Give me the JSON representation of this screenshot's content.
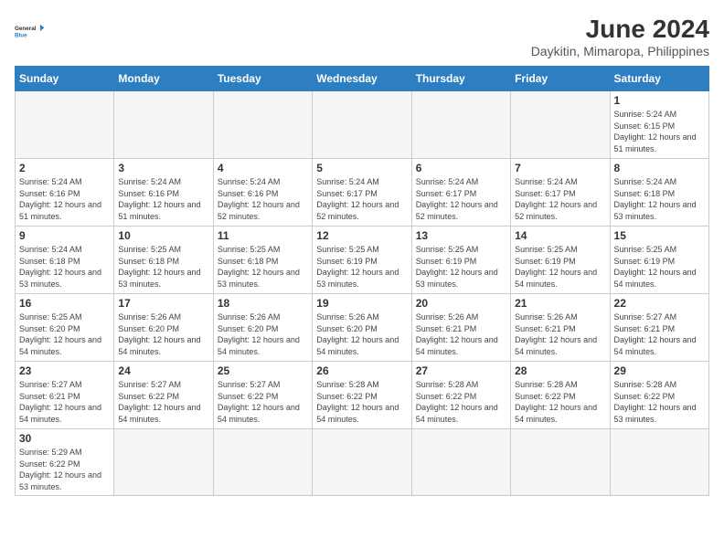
{
  "header": {
    "logo_general": "General",
    "logo_blue": "Blue",
    "main_title": "June 2024",
    "subtitle": "Daykitin, Mimaropa, Philippines"
  },
  "weekdays": [
    "Sunday",
    "Monday",
    "Tuesday",
    "Wednesday",
    "Thursday",
    "Friday",
    "Saturday"
  ],
  "weeks": [
    [
      {
        "day": null,
        "info": null
      },
      {
        "day": null,
        "info": null
      },
      {
        "day": null,
        "info": null
      },
      {
        "day": null,
        "info": null
      },
      {
        "day": null,
        "info": null
      },
      {
        "day": null,
        "info": null
      },
      {
        "day": "1",
        "info": "Sunrise: 5:24 AM\nSunset: 6:15 PM\nDaylight: 12 hours and 51 minutes."
      }
    ],
    [
      {
        "day": "2",
        "info": "Sunrise: 5:24 AM\nSunset: 6:16 PM\nDaylight: 12 hours and 51 minutes."
      },
      {
        "day": "3",
        "info": "Sunrise: 5:24 AM\nSunset: 6:16 PM\nDaylight: 12 hours and 51 minutes."
      },
      {
        "day": "4",
        "info": "Sunrise: 5:24 AM\nSunset: 6:16 PM\nDaylight: 12 hours and 52 minutes."
      },
      {
        "day": "5",
        "info": "Sunrise: 5:24 AM\nSunset: 6:17 PM\nDaylight: 12 hours and 52 minutes."
      },
      {
        "day": "6",
        "info": "Sunrise: 5:24 AM\nSunset: 6:17 PM\nDaylight: 12 hours and 52 minutes."
      },
      {
        "day": "7",
        "info": "Sunrise: 5:24 AM\nSunset: 6:17 PM\nDaylight: 12 hours and 52 minutes."
      },
      {
        "day": "8",
        "info": "Sunrise: 5:24 AM\nSunset: 6:18 PM\nDaylight: 12 hours and 53 minutes."
      }
    ],
    [
      {
        "day": "9",
        "info": "Sunrise: 5:24 AM\nSunset: 6:18 PM\nDaylight: 12 hours and 53 minutes."
      },
      {
        "day": "10",
        "info": "Sunrise: 5:25 AM\nSunset: 6:18 PM\nDaylight: 12 hours and 53 minutes."
      },
      {
        "day": "11",
        "info": "Sunrise: 5:25 AM\nSunset: 6:18 PM\nDaylight: 12 hours and 53 minutes."
      },
      {
        "day": "12",
        "info": "Sunrise: 5:25 AM\nSunset: 6:19 PM\nDaylight: 12 hours and 53 minutes."
      },
      {
        "day": "13",
        "info": "Sunrise: 5:25 AM\nSunset: 6:19 PM\nDaylight: 12 hours and 53 minutes."
      },
      {
        "day": "14",
        "info": "Sunrise: 5:25 AM\nSunset: 6:19 PM\nDaylight: 12 hours and 54 minutes."
      },
      {
        "day": "15",
        "info": "Sunrise: 5:25 AM\nSunset: 6:19 PM\nDaylight: 12 hours and 54 minutes."
      }
    ],
    [
      {
        "day": "16",
        "info": "Sunrise: 5:25 AM\nSunset: 6:20 PM\nDaylight: 12 hours and 54 minutes."
      },
      {
        "day": "17",
        "info": "Sunrise: 5:26 AM\nSunset: 6:20 PM\nDaylight: 12 hours and 54 minutes."
      },
      {
        "day": "18",
        "info": "Sunrise: 5:26 AM\nSunset: 6:20 PM\nDaylight: 12 hours and 54 minutes."
      },
      {
        "day": "19",
        "info": "Sunrise: 5:26 AM\nSunset: 6:20 PM\nDaylight: 12 hours and 54 minutes."
      },
      {
        "day": "20",
        "info": "Sunrise: 5:26 AM\nSunset: 6:21 PM\nDaylight: 12 hours and 54 minutes."
      },
      {
        "day": "21",
        "info": "Sunrise: 5:26 AM\nSunset: 6:21 PM\nDaylight: 12 hours and 54 minutes."
      },
      {
        "day": "22",
        "info": "Sunrise: 5:27 AM\nSunset: 6:21 PM\nDaylight: 12 hours and 54 minutes."
      }
    ],
    [
      {
        "day": "23",
        "info": "Sunrise: 5:27 AM\nSunset: 6:21 PM\nDaylight: 12 hours and 54 minutes."
      },
      {
        "day": "24",
        "info": "Sunrise: 5:27 AM\nSunset: 6:22 PM\nDaylight: 12 hours and 54 minutes."
      },
      {
        "day": "25",
        "info": "Sunrise: 5:27 AM\nSunset: 6:22 PM\nDaylight: 12 hours and 54 minutes."
      },
      {
        "day": "26",
        "info": "Sunrise: 5:28 AM\nSunset: 6:22 PM\nDaylight: 12 hours and 54 minutes."
      },
      {
        "day": "27",
        "info": "Sunrise: 5:28 AM\nSunset: 6:22 PM\nDaylight: 12 hours and 54 minutes."
      },
      {
        "day": "28",
        "info": "Sunrise: 5:28 AM\nSunset: 6:22 PM\nDaylight: 12 hours and 54 minutes."
      },
      {
        "day": "29",
        "info": "Sunrise: 5:28 AM\nSunset: 6:22 PM\nDaylight: 12 hours and 53 minutes."
      }
    ],
    [
      {
        "day": "30",
        "info": "Sunrise: 5:29 AM\nSunset: 6:22 PM\nDaylight: 12 hours and 53 minutes."
      },
      {
        "day": null,
        "info": null
      },
      {
        "day": null,
        "info": null
      },
      {
        "day": null,
        "info": null
      },
      {
        "day": null,
        "info": null
      },
      {
        "day": null,
        "info": null
      },
      {
        "day": null,
        "info": null
      }
    ]
  ]
}
